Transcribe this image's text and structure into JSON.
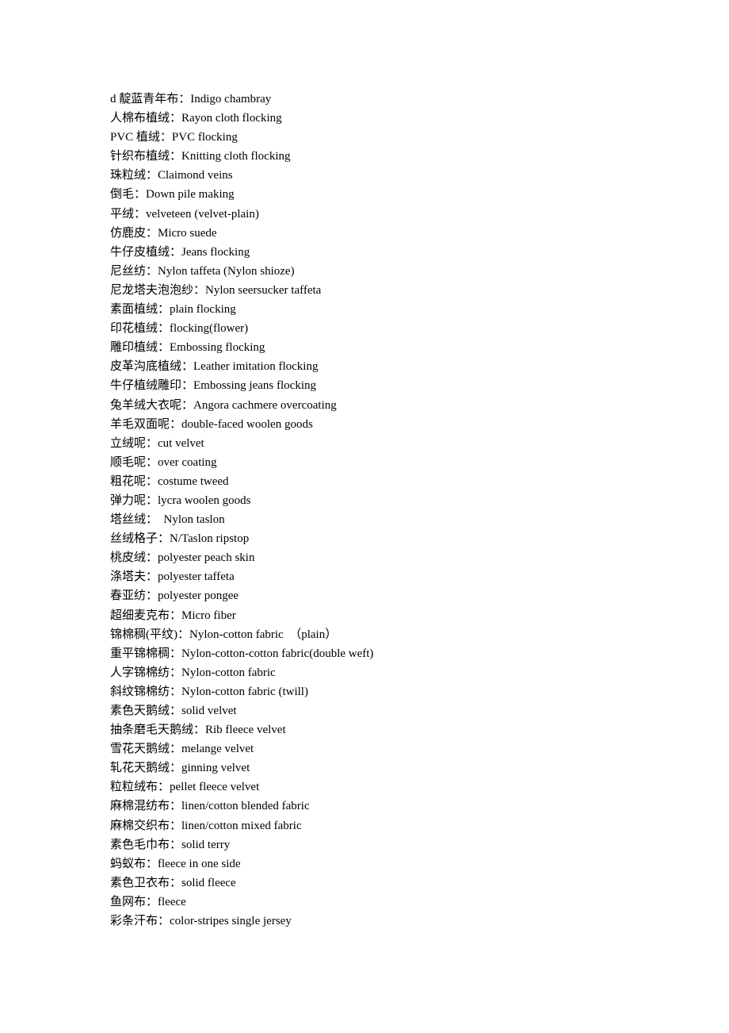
{
  "document": {
    "lines": [
      "d 靛蓝青年布：Indigo chambray",
      "人棉布植绒：Rayon cloth flocking",
      "PVC 植绒：PVC flocking",
      "针织布植绒：Knitting cloth flocking",
      "珠粒绒：Claimond veins",
      "倒毛：Down pile making",
      "平绒：velveteen (velvet-plain)",
      "仿鹿皮：Micro suede",
      "牛仔皮植绒：Jeans flocking",
      "尼丝纺：Nylon taffeta (Nylon shioze)",
      "尼龙塔夫泡泡纱：Nylon seersucker taffeta",
      "素面植绒：plain flocking",
      "印花植绒：flocking(flower)",
      "雕印植绒：Embossing flocking",
      "皮革沟底植绒：Leather imitation flocking",
      "牛仔植绒雕印：Embossing jeans flocking",
      "兔羊绒大衣呢：Angora cachmere overcoating",
      "羊毛双面呢：double-faced woolen goods",
      "立绒呢：cut velvet",
      "顺毛呢：over coating",
      "粗花呢：costume tweed",
      "弹力呢：lycra woolen goods",
      "塔丝绒：  Nylon taslon",
      "丝绒格子：N/Taslon ripstop",
      "桃皮绒：polyester peach skin",
      "涤塔夫：polyester taffeta",
      "春亚纺：polyester pongee",
      "超细麦克布：Micro fiber",
      "锦棉稠(平纹)：Nylon-cotton fabric  （plain）",
      "重平锦棉稠：Nylon-cotton-cotton fabric(double weft)",
      "人字锦棉纺：Nylon-cotton fabric",
      "斜纹锦棉纺：Nylon-cotton fabric (twill)",
      "素色天鹅绒：solid velvet",
      "抽条磨毛天鹅绒：Rib fleece velvet",
      "雪花天鹅绒：melange velvet",
      "轧花天鹅绒：ginning velvet",
      "粒粒绒布：pellet fleece velvet",
      "麻棉混纺布：linen/cotton blended fabric",
      "麻棉交织布：linen/cotton mixed fabric",
      "素色毛巾布：solid terry",
      "蚂蚁布：fleece in one side",
      "素色卫衣布：solid fleece",
      "鱼网布：fleece",
      "彩条汗布：color-stripes single jersey"
    ]
  }
}
